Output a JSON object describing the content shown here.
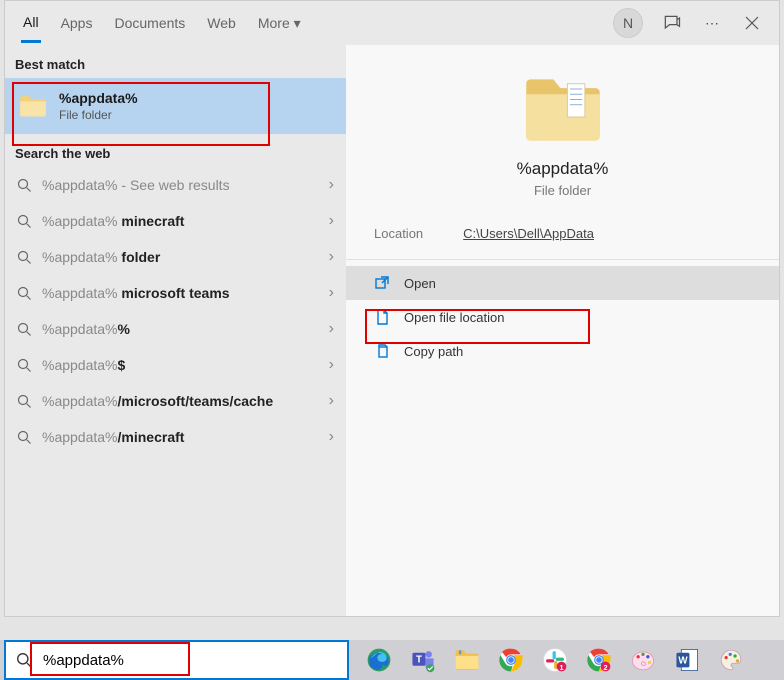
{
  "tabs": {
    "all": "All",
    "apps": "Apps",
    "documents": "Documents",
    "web": "Web",
    "more": "More"
  },
  "avatar_letter": "N",
  "sections": {
    "best_match": "Best match",
    "search_web": "Search the web"
  },
  "best_match": {
    "title": "%appdata%",
    "subtitle": "File folder"
  },
  "web_items": [
    {
      "prefix": "%appdata%",
      "suffix": "",
      "hint": " - See web results"
    },
    {
      "prefix": "%appdata%",
      "suffix": " minecraft",
      "hint": ""
    },
    {
      "prefix": "%appdata%",
      "suffix": " folder",
      "hint": ""
    },
    {
      "prefix": "%appdata%",
      "suffix": " microsoft teams",
      "hint": ""
    },
    {
      "prefix": "%appdata%",
      "suffix": "%",
      "hint": ""
    },
    {
      "prefix": "%appdata%",
      "suffix": "$",
      "hint": ""
    },
    {
      "prefix": "%appdata%",
      "suffix": "/microsoft/teams/cache",
      "hint": ""
    },
    {
      "prefix": "%appdata%",
      "suffix": "/minecraft",
      "hint": ""
    }
  ],
  "preview": {
    "title": "%appdata%",
    "subtitle": "File folder",
    "location_label": "Location",
    "location_value": "C:\\Users\\Dell\\AppData",
    "actions": {
      "open": "Open",
      "open_loc": "Open file location",
      "copy": "Copy path"
    }
  },
  "search_value": "%appdata%"
}
